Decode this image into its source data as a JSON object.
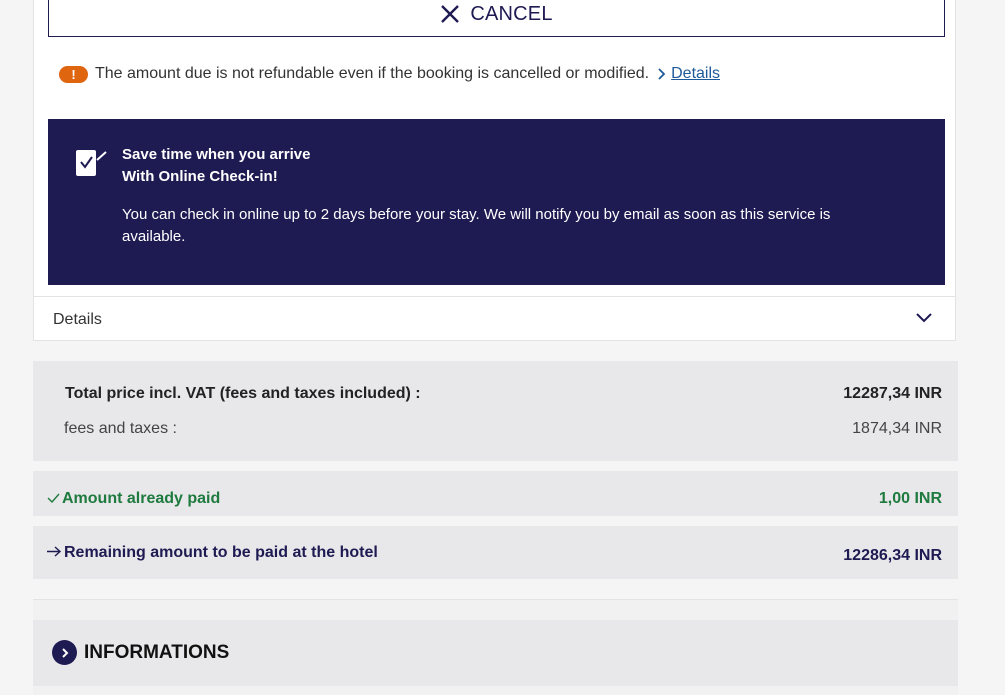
{
  "cancel": {
    "label": "CANCEL"
  },
  "notice": {
    "text": "The amount due is not refundable even if the booking is cancelled or modified.",
    "link": "Details"
  },
  "checkin": {
    "title_line1": "Save time when you arrive",
    "title_line2": "With Online Check-in!",
    "body": "You can check in online up to 2 days before your stay. We will notify you by email as soon as this service is available."
  },
  "details": {
    "label": "Details"
  },
  "price": {
    "total_label": "Total price incl. VAT (fees and taxes included) :",
    "total_value": "12287,34 INR",
    "fees_label": "fees and taxes :",
    "fees_value": "1874,34 INR"
  },
  "paid": {
    "label": "Amount already paid",
    "value": "1,00 INR"
  },
  "remaining": {
    "label": "Remaining amount to be paid at the hotel",
    "value": "12286,34 INR"
  },
  "informations": {
    "title": "INFORMATIONS"
  },
  "colors": {
    "brand_navy": "#1e1a52",
    "warning_orange": "#e0650f",
    "success_green": "#1e7a3e",
    "link_blue": "#1e5a9a"
  },
  "icons": [
    "close-icon",
    "warning-icon",
    "chevron-right-icon",
    "checkin-icon",
    "chevron-down-icon",
    "check-icon",
    "arrow-right-icon"
  ]
}
